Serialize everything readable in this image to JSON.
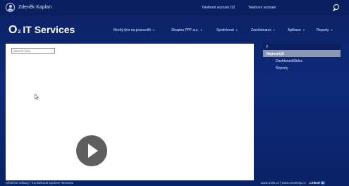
{
  "topbar": {
    "user_name": "Zdeněk Kaplan",
    "links": [
      "Telefonní seznam O2",
      "Telefonní seznam"
    ]
  },
  "brand": {
    "name_o": "O",
    "name_sub": "2",
    "name_rest": "IT Services"
  },
  "nav": {
    "items": [
      "Modrý tým na pracovišti",
      "Skupina PPF a.s.",
      "Společnost",
      "Zaměstnanci",
      "Aplikace",
      "Reporty"
    ]
  },
  "main": {
    "search_placeholder": "Search here"
  },
  "sidepanel": {
    "header": "f",
    "active": "Nejnovější",
    "items": [
      "DashboardSlides",
      "Reporty"
    ]
  },
  "footer": {
    "left": "Užitečné odkazy  |  Kontaktovat správce intranetu",
    "right": "www.o2its.cz | www.smartcity.cz",
    "linkedin_text": "Linked",
    "linkedin_badge": "in"
  }
}
